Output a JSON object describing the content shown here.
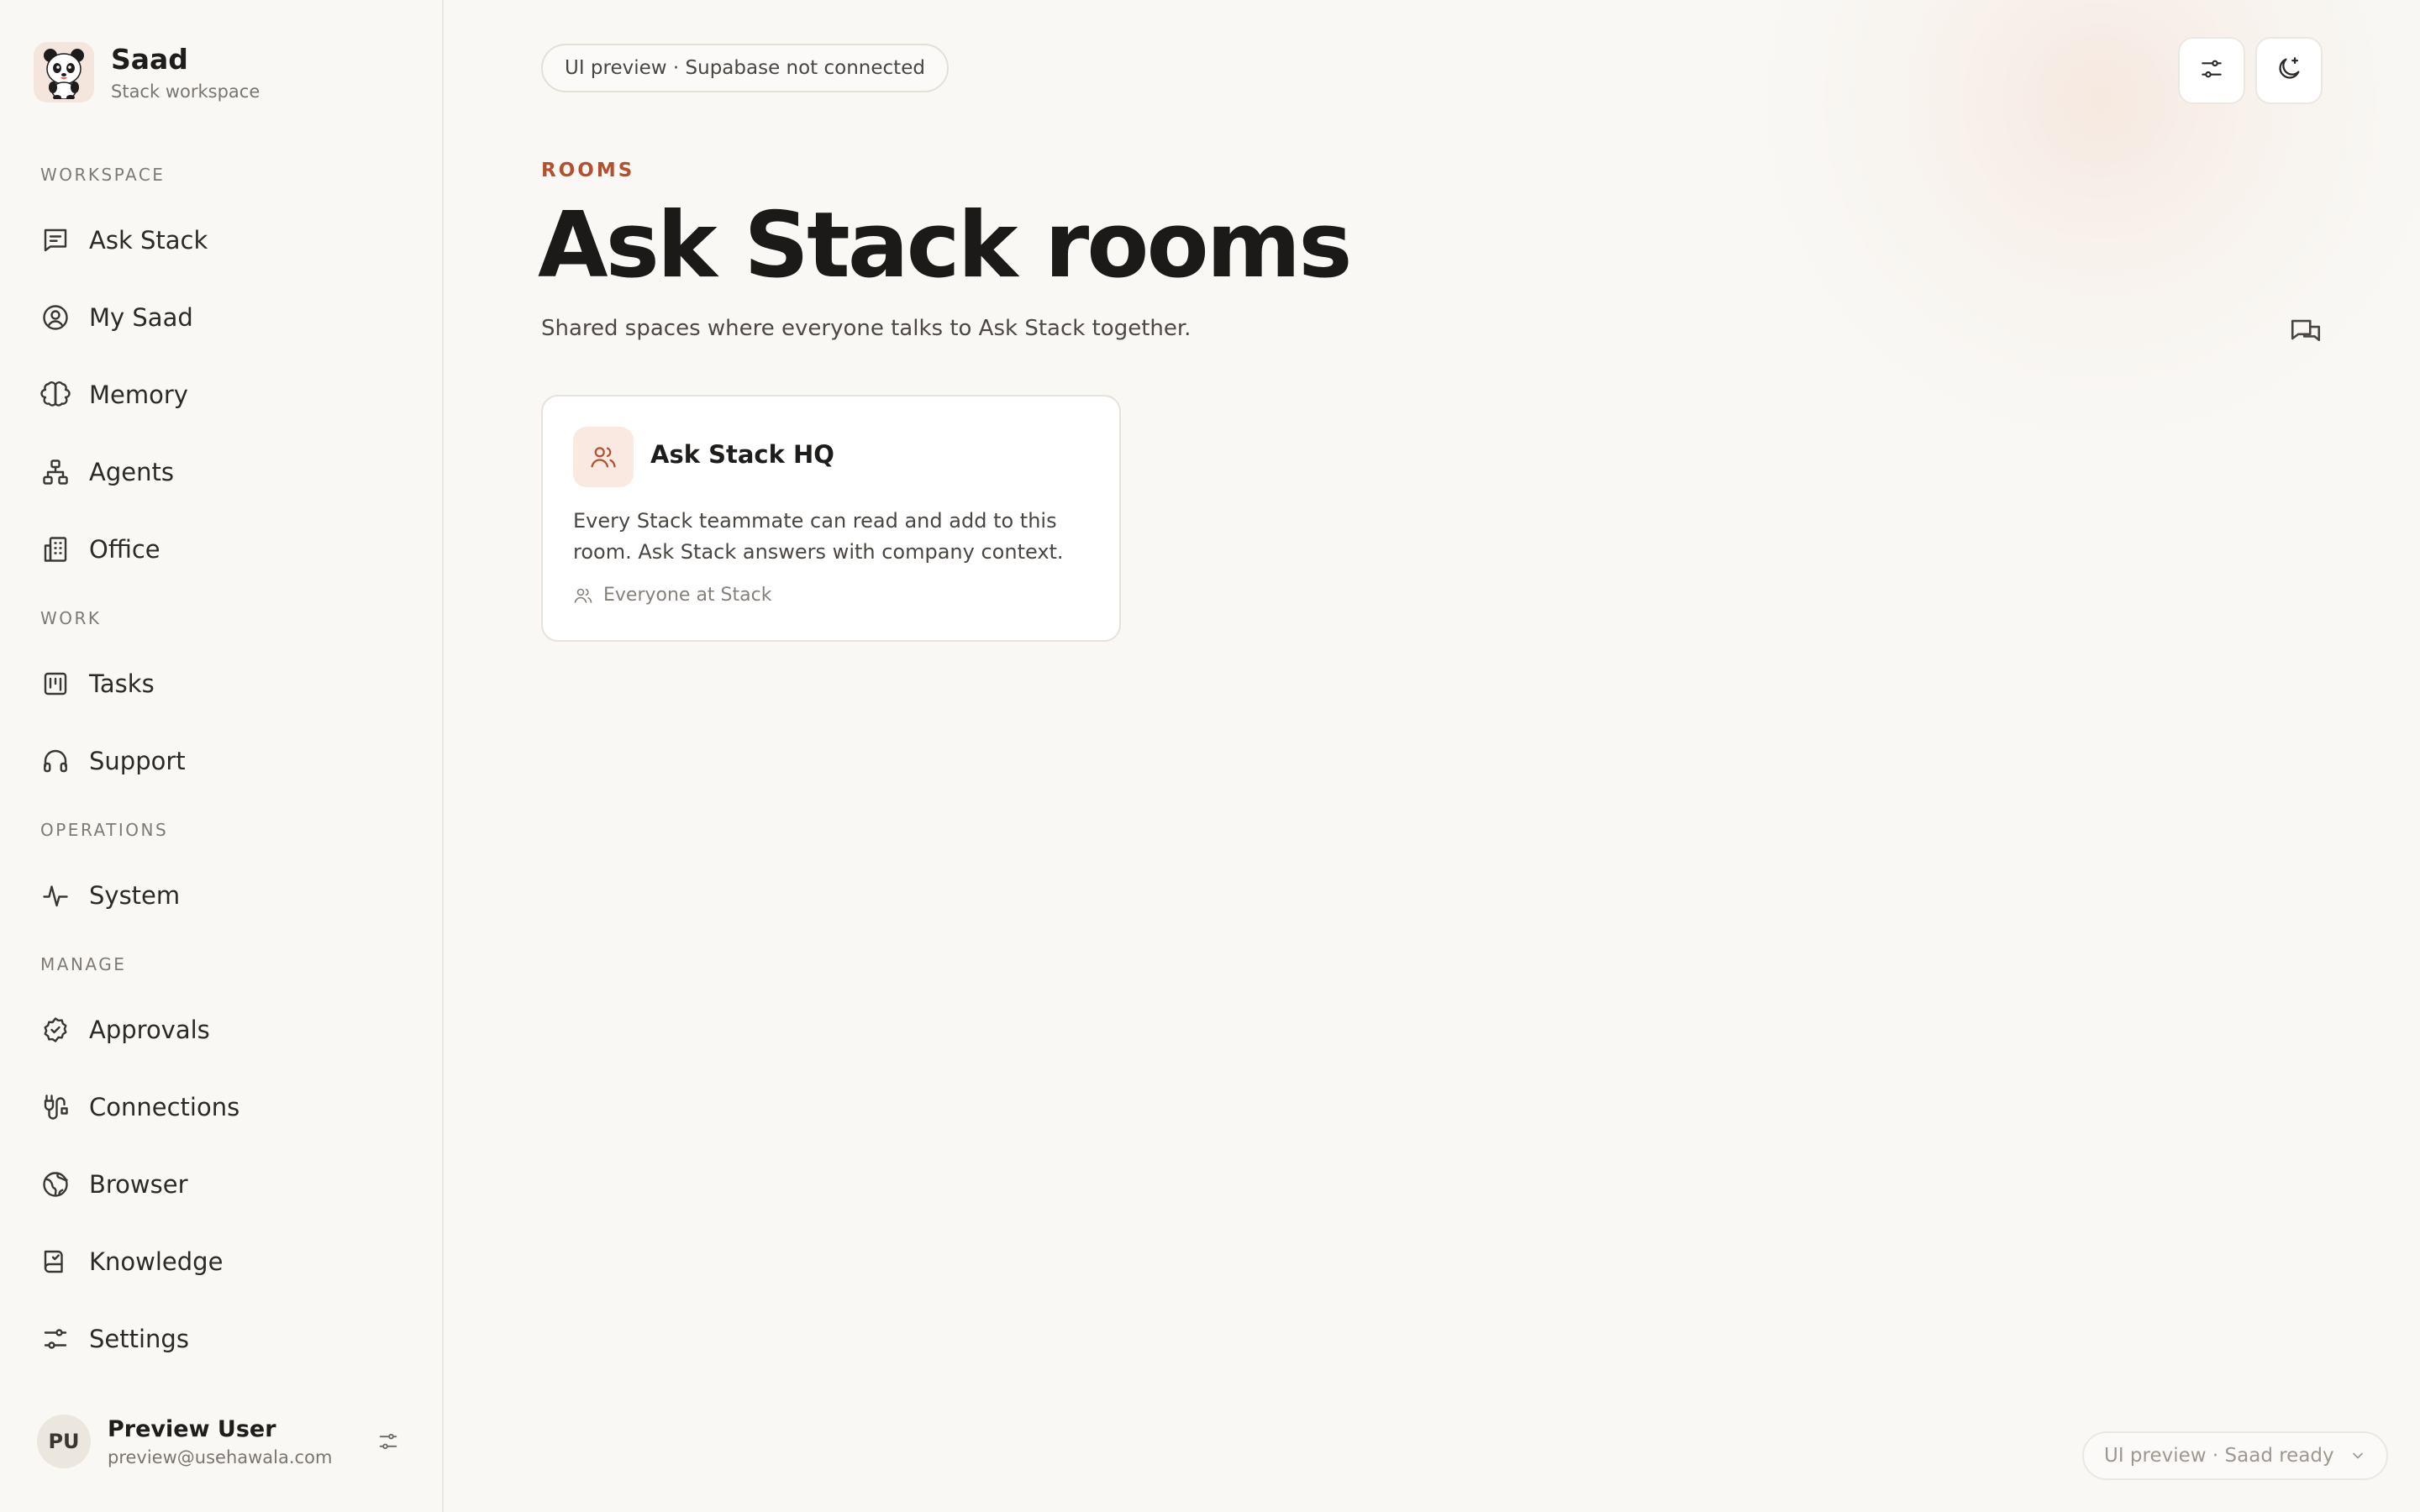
{
  "brand": {
    "name": "Saad",
    "subtitle": "Stack workspace"
  },
  "sidebar": {
    "sections": {
      "workspace": "WORKSPACE",
      "work": "WORK",
      "operations": "OPERATIONS",
      "manage": "MANAGE"
    },
    "items": {
      "ask_stack": "Ask Stack",
      "my_saad": "My Saad",
      "memory": "Memory",
      "agents": "Agents",
      "office": "Office",
      "tasks": "Tasks",
      "support": "Support",
      "system": "System",
      "approvals": "Approvals",
      "connections": "Connections",
      "browser": "Browser",
      "knowledge": "Knowledge",
      "settings": "Settings"
    }
  },
  "user": {
    "initials": "PU",
    "name": "Preview User",
    "email": "preview@usehawala.com"
  },
  "header": {
    "status_pill": "UI preview · Supabase not connected"
  },
  "page": {
    "eyebrow": "ROOMS",
    "title": "Ask Stack rooms",
    "description": "Shared spaces where everyone talks to Ask Stack together."
  },
  "rooms": [
    {
      "title": "Ask Stack HQ",
      "description": "Every Stack teammate can read and add to this room. Ask Stack answers with company context.",
      "audience": "Everyone at Stack"
    }
  ],
  "footer": {
    "status": "UI preview · Saad ready"
  },
  "colors": {
    "accent": "#b5502e",
    "background": "#f9f8f5",
    "card": "#ffffff"
  }
}
